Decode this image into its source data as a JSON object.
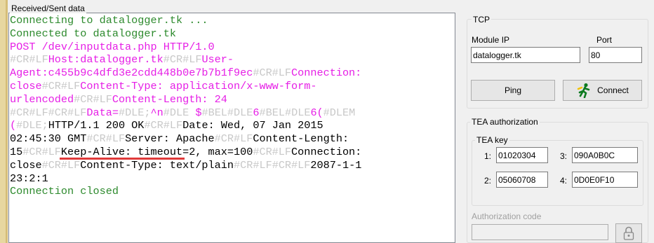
{
  "log": {
    "title": "Received/Sent data",
    "lines": [
      [
        {
          "t": "Connecting to datalogger.tk ...",
          "c": "lg"
        }
      ],
      [
        {
          "t": "Connected to datalogger.tk",
          "c": "lg"
        }
      ],
      [
        {
          "t": "POST /dev/inputdata.php HTTP/1.0",
          "c": "lm"
        }
      ],
      [
        {
          "t": "#CR#LF",
          "c": "lc"
        },
        {
          "t": "Host:datalogger.tk",
          "c": "lm"
        },
        {
          "t": "#CR#LF",
          "c": "lc"
        },
        {
          "t": "User-",
          "c": "lm"
        }
      ],
      [
        {
          "t": "Agent:c455b9c4dfd3e2cdd448b0e7b7b1f9ec",
          "c": "lm"
        },
        {
          "t": "#CR#LF",
          "c": "lc"
        },
        {
          "t": "Connection:",
          "c": "lm"
        }
      ],
      [
        {
          "t": "close",
          "c": "lm"
        },
        {
          "t": "#CR#LF",
          "c": "lc"
        },
        {
          "t": "Content-Type: application/x-www-form-",
          "c": "lm"
        }
      ],
      [
        {
          "t": "urlencoded",
          "c": "lm"
        },
        {
          "t": "#CR#LF",
          "c": "lc"
        },
        {
          "t": "Content-Length: 24",
          "c": "lm"
        }
      ],
      [
        {
          "t": "#CR#LF#CR#LF",
          "c": "lc"
        },
        {
          "t": "Data=",
          "c": "lm"
        },
        {
          "t": "#DLE;",
          "c": "lc"
        },
        {
          "t": "^n",
          "c": "lm"
        },
        {
          "t": "#DLE ",
          "c": "lc"
        },
        {
          "t": "$",
          "c": "lm"
        },
        {
          "t": "#BEL#DLE",
          "c": "lc"
        },
        {
          "t": "6",
          "c": "lm"
        },
        {
          "t": "#BEL#DLE",
          "c": "lc"
        },
        {
          "t": "6(",
          "c": "lm"
        },
        {
          "t": "#DLEM",
          "c": "lc"
        }
      ],
      [
        {
          "t": "(",
          "c": "lm"
        },
        {
          "t": "#DLE;",
          "c": "lc"
        },
        {
          "t": "HTTP/1.1 200 OK",
          "c": "lk"
        },
        {
          "t": "#CR#LF",
          "c": "lc"
        },
        {
          "t": "Date: Wed, 07 Jan 2015",
          "c": "lk"
        }
      ],
      [
        {
          "t": "02:45:30 GMT",
          "c": "lk"
        },
        {
          "t": "#CR#LF",
          "c": "lc"
        },
        {
          "t": "Server: Apache",
          "c": "lk"
        },
        {
          "t": "#CR#LF",
          "c": "lc"
        },
        {
          "t": "Content-Length:",
          "c": "lk"
        }
      ],
      [
        {
          "t": "15",
          "c": "lk"
        },
        {
          "t": "#CR#LF",
          "c": "lc"
        },
        {
          "t": "Keep-Alive: timeout=2, max=100",
          "c": "lk"
        },
        {
          "t": "#CR#LF",
          "c": "lc"
        },
        {
          "t": "Connection:",
          "c": "lk"
        }
      ],
      [
        {
          "t": "close",
          "c": "lk"
        },
        {
          "t": "#CR#LF",
          "c": "lc"
        },
        {
          "t": "Content-Type: text/plain",
          "c": "lk"
        },
        {
          "t": "#CR#LF#CR#LF",
          "c": "lc"
        },
        {
          "t": "2087-1-1",
          "c": "lk"
        }
      ],
      [
        {
          "t": "23:2:1",
          "c": "lk"
        }
      ],
      [
        {
          "t": "Connection closed",
          "c": "lg"
        }
      ]
    ]
  },
  "tcp": {
    "title": "TCP",
    "module_ip_label": "Module IP",
    "port_label": "Port",
    "module_ip_value": "datalogger.tk",
    "port_value": "80",
    "ping_label": "Ping",
    "connect_label": "Connect"
  },
  "tea": {
    "title": "TEA authorization",
    "key_title": "TEA key",
    "keys": [
      {
        "n": "1:",
        "v": "01020304"
      },
      {
        "n": "3:",
        "v": "090A0B0C"
      },
      {
        "n": "2:",
        "v": "05060708"
      },
      {
        "n": "4:",
        "v": "0D0E0F10"
      }
    ],
    "auth_code_label": "Authorization code",
    "auth_code_value": ""
  },
  "colors": {
    "log_green": "#2d8a2d",
    "log_magenta": "#e61ee6",
    "control_chars": "#c8c8c8",
    "underline": "#e03a3a"
  }
}
